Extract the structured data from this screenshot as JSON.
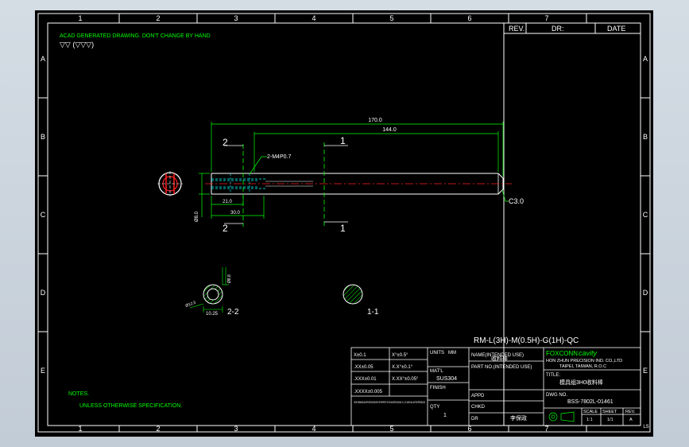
{
  "viewer": {
    "background": "#c8d0d8"
  },
  "colors": {
    "frame": "#ffffff",
    "green": "#00ff00",
    "cyan": "#00ffff",
    "red": "#ff2020",
    "yellow": "#ffff00"
  },
  "border": {
    "columns": [
      "1",
      "2",
      "3",
      "4",
      "5",
      "6",
      "7"
    ],
    "rows": [
      "A",
      "B",
      "C",
      "D",
      "E"
    ],
    "corner_mark": "LS"
  },
  "revision_block": {
    "rev": "REV.",
    "dr": "DR:",
    "date": "DATE"
  },
  "notes": {
    "header_line": "ACAD GENERATED DRAWING. DON'T CHANGE BY HAND",
    "finish_symbols": "▽▽ (▽▽▽)",
    "notes_label": "NOTES.",
    "unless": "UNLESS OTHERWISE SPECIFICATION."
  },
  "drawing": {
    "dim_overall": "170.0",
    "dim_inner": "144.0",
    "dim_thread_len": "21.0",
    "dim_hole_len": "30.0",
    "dim_dia": "Ø8.0",
    "thread_note": "2-M4P0.7",
    "chamfer": "C3.0",
    "section_a_num": "2",
    "section_b_num": "1",
    "section_22": "2-2",
    "section_11": "1-1",
    "sec_dim_1": "Ø12.5",
    "sec_dim_2": "10.25",
    "sec_dim_3": "Ø8.8"
  },
  "part_number": "RM-L(3H)-M(0.5H)-G(1H)-QC",
  "title_block": {
    "tol_x": "X±0.1",
    "tol_xx": ".XX±0.05",
    "tol_xxx": ".XXX±0.01",
    "tol_xxxx": ".XXXX±0.005",
    "tol_angle": "X°±0.5°",
    "tol_angle2": "X.X°±0.1°",
    "tol_angle3": "X.XX°±0.05°",
    "units_label": "UNITS",
    "units_value": "MM",
    "matl_label": "MAT'L",
    "matl_value": "SUS304",
    "finish_label": "FINISH",
    "qty_label": "QTY",
    "qty_value": "1",
    "proprietary": "THESE DRAWINGS AND SPECIFICATIONS ARE THE PROPERTY OF HON HAI PRECISION IND. CO., LTD. AND SHALL NOT BE REPRODUCED",
    "name_label": "NAME(INTENDED USE)",
    "name_value": "收料棒",
    "part_no_label": "PART NO.(INTENDED USE)",
    "appd_label": "APPD",
    "chkd_label": "CHKD",
    "dr_label": "DR",
    "dr_value": "李保政",
    "company_logo": "FOXCONN",
    "company_cavity": "cavity",
    "company_name": "HON ZHUN PRECISION IND. CO.,LTD",
    "company_city": "TAIPEI, TAIWAN, R.O.C",
    "title_label": "TITLE:",
    "title_value": "模具组3H0收料棒",
    "dwg_label": "DWG NO.",
    "dwg_value": "BSS-7802L-01461",
    "scale_label": "SCALE",
    "sheet_label": "SHEET",
    "rev_label": "REV.",
    "scale_value": "1:1",
    "sheet_value": "1/1",
    "rev_value": "A"
  }
}
